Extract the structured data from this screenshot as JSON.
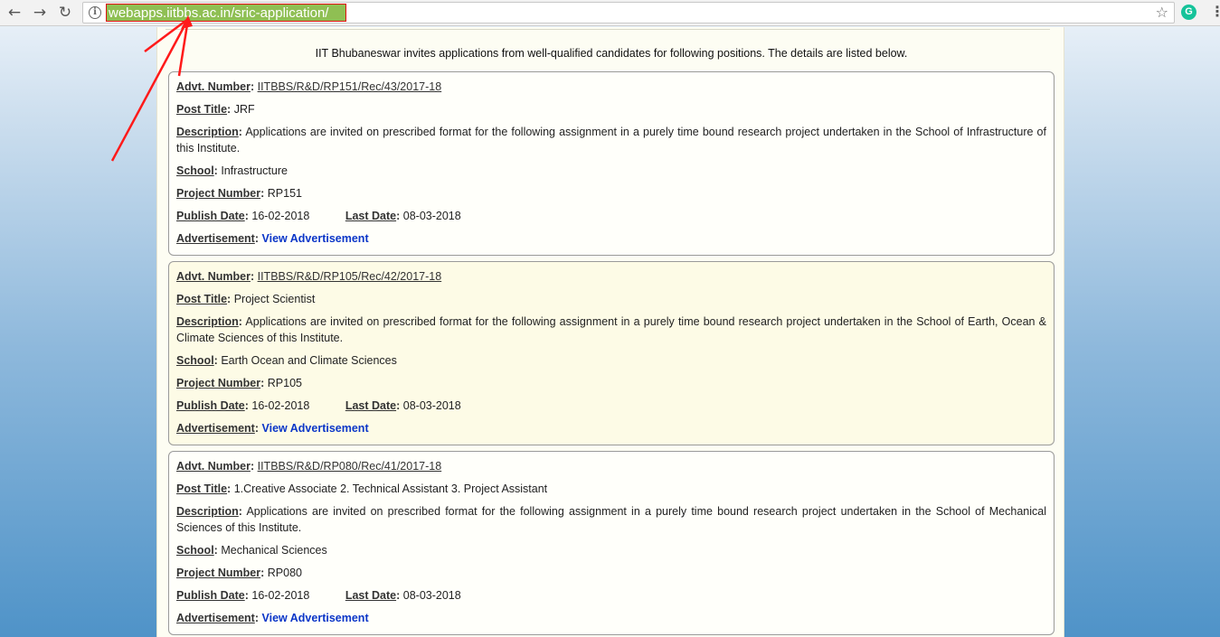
{
  "browser": {
    "url": "webapps.iitbbs.ac.in/sric-application/"
  },
  "intro": "IIT Bhubaneswar invites applications from well-qualified candidates for following positions. The details are listed below.",
  "labels": {
    "advt_number": "Advt. Number",
    "post_title": "Post Title",
    "description": "Description",
    "school": "School",
    "project_number": "Project Number",
    "publish_date": "Publish Date",
    "last_date": "Last Date",
    "advertisement": "Advertisement",
    "colon": ":"
  },
  "positions": [
    {
      "advt_number": "IITBBS/R&D/RP151/Rec/43/2017-18",
      "post_title": "JRF",
      "description": "Applications are invited on prescribed format for the following assignment in a purely time bound research project undertaken in the School of Infrastructure of this Institute.",
      "school": "Infrastructure",
      "project_number": "RP151",
      "publish_date": "16-02-2018",
      "last_date": "08-03-2018",
      "advertisement_link": "View Advertisement"
    },
    {
      "advt_number": "IITBBS/R&D/RP105/Rec/42/2017-18",
      "post_title": "Project Scientist",
      "description": "Applications are invited on prescribed format for the following assignment in a purely time bound research project undertaken in the School of Earth, Ocean & Climate Sciences of this Institute.",
      "school": "Earth Ocean and Climate Sciences",
      "project_number": "RP105",
      "publish_date": "16-02-2018",
      "last_date": "08-03-2018",
      "advertisement_link": "View Advertisement"
    },
    {
      "advt_number": "IITBBS/R&D/RP080/Rec/41/2017-18",
      "post_title": "1.Creative Associate 2. Technical Assistant 3. Project Assistant",
      "description": "Applications are invited on prescribed format for the following assignment in a purely time bound research project undertaken in the School of Mechanical Sciences of this Institute.",
      "school": "Mechanical Sciences",
      "project_number": "RP080",
      "publish_date": "16-02-2018",
      "last_date": "08-03-2018",
      "advertisement_link": "View Advertisement"
    }
  ]
}
